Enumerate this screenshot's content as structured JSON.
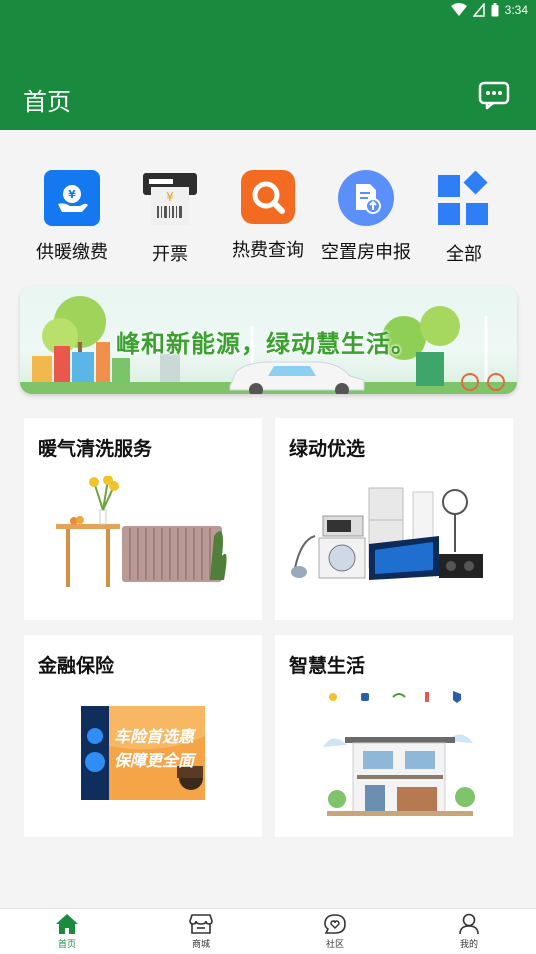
{
  "status_bar": {
    "time": "3:34",
    "icons": [
      "wifi-icon",
      "signal-icon",
      "battery-icon"
    ]
  },
  "header": {
    "title": "首页",
    "message_icon": "message-icon"
  },
  "quick_actions": [
    {
      "label": "供暖缴费",
      "icon": "pay-icon",
      "color": "#1478f0"
    },
    {
      "label": "开票",
      "icon": "invoice-icon",
      "color": "#2e2e2e"
    },
    {
      "label": "热费查询",
      "icon": "search-icon",
      "color": "#f26b21"
    },
    {
      "label": "空置房申报",
      "icon": "declare-icon",
      "color": "#5b8ff9"
    },
    {
      "label": "全部",
      "icon": "all-icon",
      "color": "#2f7ef5"
    }
  ],
  "banner": {
    "text": "峰和新能源，绿动慧生活。"
  },
  "cards": [
    {
      "title": "暖气清洗服务"
    },
    {
      "title": "绿动优选"
    },
    {
      "title": "金融保险"
    },
    {
      "title": "智慧生活"
    }
  ],
  "finance_card_image_text": [
    "车险首选惠",
    "保障更全面"
  ],
  "tabs": [
    {
      "label": "首页",
      "icon": "home-icon",
      "active": true
    },
    {
      "label": "商城",
      "icon": "shop-icon",
      "active": false
    },
    {
      "label": "社区",
      "icon": "community-icon",
      "active": false
    },
    {
      "label": "我的",
      "icon": "profile-icon",
      "active": false
    }
  ],
  "colors": {
    "primary": "#1a8a3e",
    "background": "#f4f4f4"
  }
}
